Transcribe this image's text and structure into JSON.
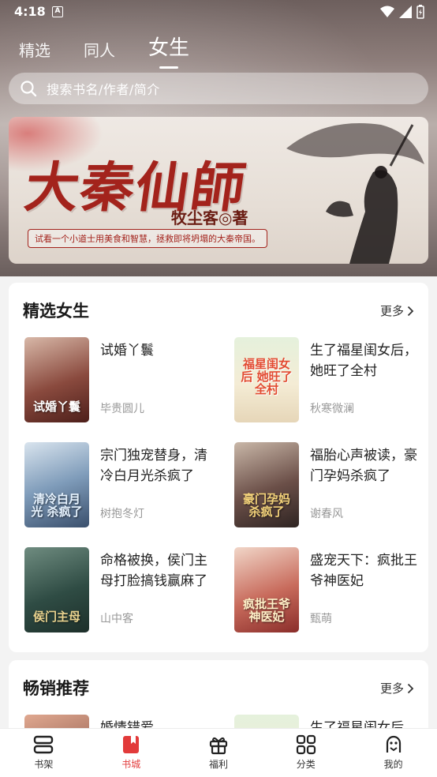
{
  "status": {
    "time": "4:18",
    "notif_letter": "A"
  },
  "top_tabs": [
    {
      "label": "精选",
      "active": false
    },
    {
      "label": "同人",
      "active": false
    },
    {
      "label": "女生",
      "active": true
    }
  ],
  "search": {
    "placeholder": "搜索书名/作者/简介"
  },
  "banner": {
    "title": "大秦仙師",
    "author": "牧尘客◎著",
    "slogan": "试看一个小道士用美食和智慧，拯救即将坍塌的大秦帝国。"
  },
  "section1": {
    "title": "精选女生",
    "more": "更多",
    "books": [
      {
        "title": "试婚丫鬟",
        "author": "毕贵圆儿",
        "cover_text": "试婚丫鬟",
        "cover_color": "#7a2a2a"
      },
      {
        "title": "生了福星闺女后，她旺了全村",
        "author": "秋寒微澜",
        "cover_text": "福星闺女后 她旺了全村",
        "cover_color": "#cfe3c4"
      },
      {
        "title": "宗门独宠替身，清冷白月光杀疯了",
        "author": "树抱冬灯",
        "cover_text": "清冷白月光 杀疯了",
        "cover_color": "#4c6a8c"
      },
      {
        "title": "福胎心声被读，豪门孕妈杀疯了",
        "author": "谢春风",
        "cover_text": "豪门孕妈 杀疯了",
        "cover_color": "#5b4a4a"
      },
      {
        "title": "命格被换，侯门主母打脸搞钱赢麻了",
        "author": "山中客",
        "cover_text": "侯门主母",
        "cover_color": "#2f4c44"
      },
      {
        "title": "盛宠天下：疯批王爷神医妃",
        "author": "甄萌",
        "cover_text": "疯批王爷 神医妃",
        "cover_color": "#9b3a3a"
      }
    ]
  },
  "section2": {
    "title": "畅销推荐",
    "more": "更多",
    "books": [
      {
        "title": "婚情错爱"
      },
      {
        "title": "生了福星闺女后"
      }
    ]
  },
  "bottom_nav": [
    {
      "label": "书架",
      "icon": "bookshelf-icon",
      "active": false
    },
    {
      "label": "书城",
      "icon": "book-store-icon",
      "active": true
    },
    {
      "label": "福利",
      "icon": "gift-icon",
      "active": false
    },
    {
      "label": "分类",
      "icon": "category-grid-icon",
      "active": false
    },
    {
      "label": "我的",
      "icon": "profile-icon",
      "active": false
    }
  ],
  "colors": {
    "accent": "#e23a3a",
    "banner_red": "#a3231c"
  }
}
